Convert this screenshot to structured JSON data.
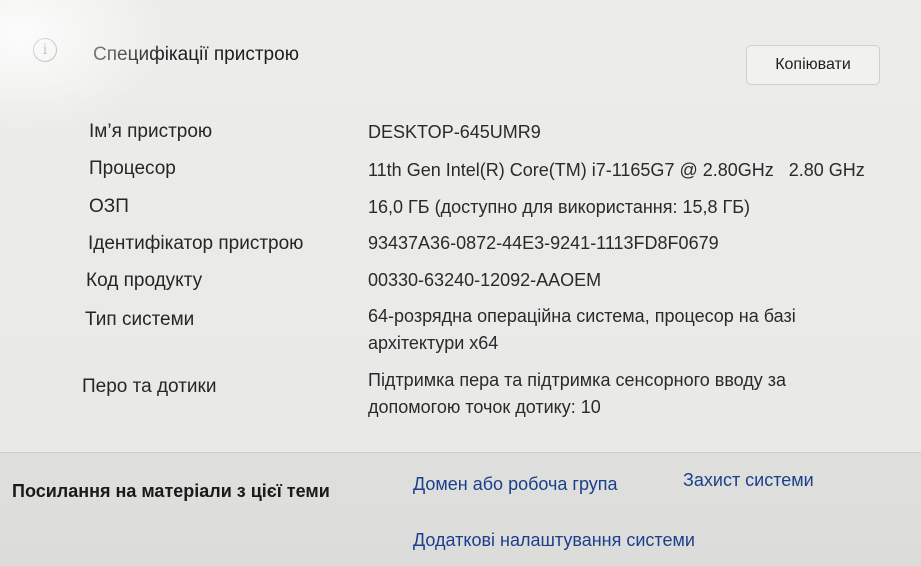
{
  "header": {
    "title": "Специфікації пристрою",
    "copy_label": "Копіювати",
    "icon": "info-icon"
  },
  "specs": [
    {
      "label": "Ім’я пристрою",
      "value": "DESKTOP-645UMR9"
    },
    {
      "label": "Процесор",
      "value": "11th Gen Intel(R) Core(TM) i7-1165G7 @ 2.80GHz   2.80 GHz"
    },
    {
      "label": "ОЗП",
      "value": "16,0 ГБ (доступно для використання: 15,8 ГБ)"
    },
    {
      "label": "Ідентифікатор пристрою",
      "value": "93437A36-0872-44E3-9241-1113FD8F0679"
    },
    {
      "label": "Код продукту",
      "value": "00330-63240-12092-AAOEM"
    },
    {
      "label": "Тип системи",
      "value": "64-розрядна операційна система, процесор на базі архітектури x64"
    },
    {
      "label": "Перо та дотики",
      "value": "Підтримка пера та підтримка сенсорного вводу за допомогою точок дотику: 10"
    }
  ],
  "related": {
    "label": "Посилання на матеріали з цієї теми",
    "links": [
      "Домен або робоча група",
      "Захист системи",
      "Додаткові налаштування системи"
    ],
    "link_color": "#1b3f8c"
  }
}
